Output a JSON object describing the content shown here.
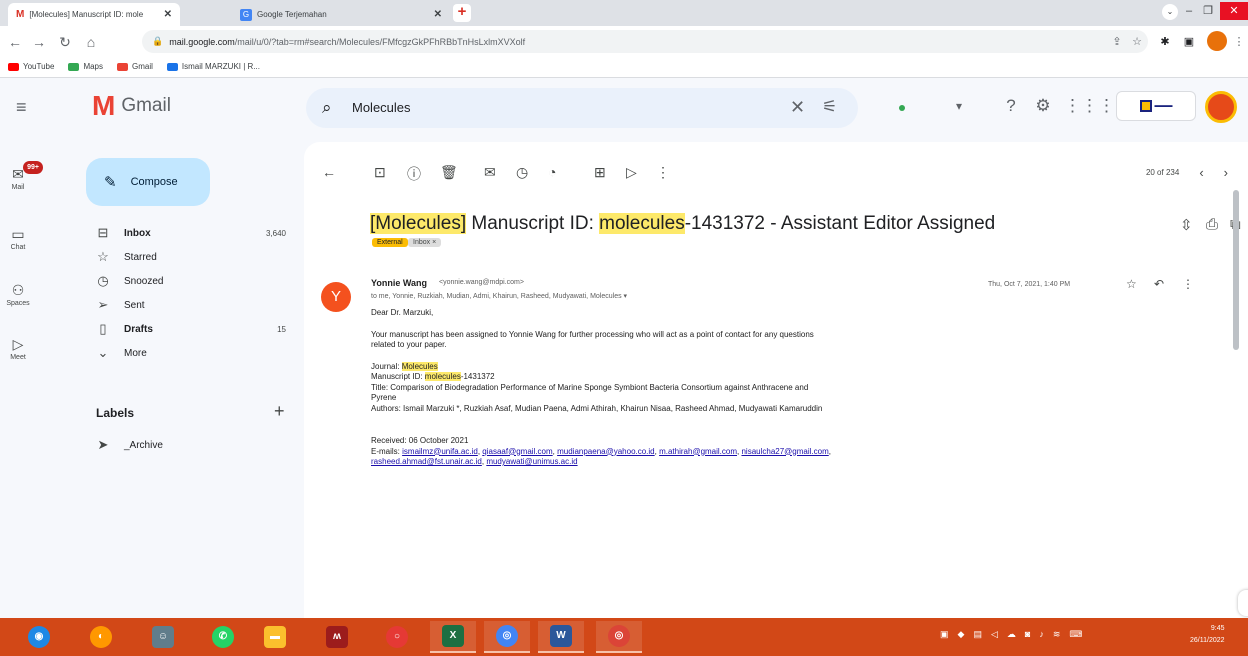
{
  "browser": {
    "tabs": [
      {
        "title": "[Molecules] Manuscript ID: mole",
        "close": "✕"
      },
      {
        "title": "Google Terjemahan",
        "close": "✕"
      }
    ],
    "new_tab": "+",
    "url_host": "mail.google.com",
    "url_path": "/mail/u/0/?tab=rm#search/Molecules/FMfcgzGkPFhRBbTnHsLxlmXVXolf",
    "bookmarks": [
      {
        "label": "YouTube",
        "color": "#ff0000"
      },
      {
        "label": "Maps",
        "color": "#34a853"
      },
      {
        "label": "Gmail",
        "color": "#ea4335"
      },
      {
        "label": "Ismail MARZUKI | R...",
        "color": "#1a73e8"
      }
    ]
  },
  "gmail": {
    "app_name": "Gmail",
    "search_value": "Molecules",
    "rail": [
      {
        "label": "Mail",
        "icon": "mail-icon",
        "badge": "99+"
      },
      {
        "label": "Chat",
        "icon": "chat-icon"
      },
      {
        "label": "Spaces",
        "icon": "spaces-icon"
      },
      {
        "label": "Meet",
        "icon": "meet-icon"
      }
    ],
    "compose_label": "Compose",
    "nav": [
      {
        "label": "Inbox",
        "count": "3,640",
        "icon": "inbox-icon",
        "bold": true
      },
      {
        "label": "Starred",
        "count": "",
        "icon": "star-icon",
        "bold": false
      },
      {
        "label": "Snoozed",
        "count": "",
        "icon": "snooze-icon",
        "bold": false
      },
      {
        "label": "Sent",
        "count": "",
        "icon": "send-icon",
        "bold": false
      },
      {
        "label": "Drafts",
        "count": "15",
        "icon": "draft-icon",
        "bold": true
      },
      {
        "label": "More",
        "count": "",
        "icon": "chevron-down-icon",
        "bold": false
      }
    ],
    "labels_title": "Labels",
    "labels": [
      {
        "label": "_Archive"
      }
    ]
  },
  "message": {
    "pager": "20 of 234",
    "subject_parts": {
      "p1": "[Molecules]",
      "p2": " Manuscript ID: ",
      "p3": "molecules",
      "p4": "-1431372 - Assistant Editor Assigned"
    },
    "tags": {
      "external": "External",
      "inbox": "Inbox ×"
    },
    "sender_initial": "Y",
    "sender_name": "Yonnie Wang",
    "sender_email": "<yonnie.wang@mdpi.com>",
    "recipients": "to me, Yonnie, Ruzkiah, Mudian, Admi, Khairun, Rasheed, Mudyawati, Molecules ▾",
    "date": "Thu, Oct 7, 2021, 1:40 PM",
    "body": {
      "greeting": "Dear Dr. Marzuki,",
      "para1": "Your manuscript has been assigned to Yonnie Wang for further processing who will act as a point of contact for any questions related to your paper.",
      "journal_label": "Journal: ",
      "journal": "Molecules",
      "msid_label": "Manuscript ID: ",
      "msid_hl": "molecules",
      "msid_rest": "-1431372",
      "title": "Title: Comparison of Biodegradation Performance of Marine Sponge Symbiont Bacteria Consortium against Anthracene and Pyrene",
      "authors": "Authors: Ismail Marzuki *, Ruzkiah Asaf, Mudian Paena, Admi Athirah, Khairun Nisaa, Rasheed Ahmad, Mudyawati Kamaruddin",
      "received": "Received: 06 October 2021",
      "emails_label": "E-mails: ",
      "emails": [
        "ismailmz@unifa.ac.id",
        "qiasaaf@gmail.com",
        "mudianpaena@yahoo.co.id",
        "m.athirah@gmail.com",
        "nisaulcha27@gmail.com",
        "rasheed.ahmad@fst.unair.ac.id",
        "mudyawati@unimus.ac.id"
      ]
    }
  },
  "taskbar": {
    "clock_time": "9:45",
    "clock_date": "26/11/2022"
  }
}
